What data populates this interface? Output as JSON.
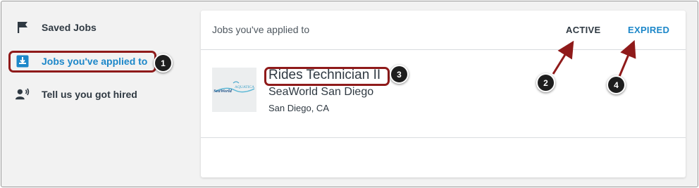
{
  "sidebar": {
    "items": [
      {
        "label": "Saved Jobs",
        "icon": "flag-icon"
      },
      {
        "label": "Jobs you've applied to",
        "icon": "inbox-download-icon",
        "active": true
      },
      {
        "label": "Tell us you got hired",
        "icon": "person-announce-icon"
      }
    ]
  },
  "panel": {
    "title": "Jobs you've applied to",
    "tabs": [
      {
        "label": "ACTIVE"
      },
      {
        "label": "EXPIRED",
        "color": "#1c87c9"
      }
    ]
  },
  "job": {
    "title": "Rides Technician II",
    "company": "SeaWorld San Diego",
    "location": "San Diego, CA",
    "logo_text_left": "SeaWorld",
    "logo_text_right": "AQUATICA"
  },
  "callouts": [
    "1",
    "2",
    "3",
    "4"
  ],
  "colors": {
    "accent": "#1c87c9",
    "callout_red": "#8f1a1a",
    "text": "#2f3942",
    "sidebar_bg": "#f2f2f2"
  }
}
